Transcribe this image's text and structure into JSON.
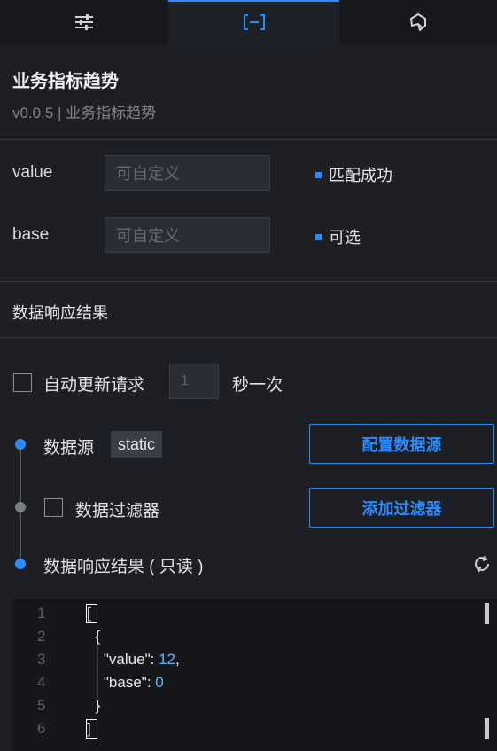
{
  "tabs": [
    {
      "name": "settings-sliders-icon"
    },
    {
      "name": "data-bracket-icon",
      "label": "[–]"
    },
    {
      "name": "interaction-icon"
    }
  ],
  "component": {
    "title": "业务指标趋势",
    "subtitle": "v0.0.5 | 业务指标趋势"
  },
  "fields": [
    {
      "label": "value",
      "placeholder": "可自定义",
      "status": "匹配成功"
    },
    {
      "label": "base",
      "placeholder": "可自定义",
      "status": "可选"
    }
  ],
  "section_title": "数据响应结果",
  "auto_update": {
    "label": "自动更新请求",
    "interval": "1",
    "suffix": "秒一次"
  },
  "datasource": {
    "label": "数据源",
    "type": "static",
    "button": "配置数据源"
  },
  "filter": {
    "label": "数据过滤器",
    "button": "添加过滤器"
  },
  "response": {
    "label": "数据响应结果 ( 只读 )"
  },
  "code": {
    "line_numbers": [
      "1",
      "2",
      "3",
      "4",
      "5",
      "6"
    ],
    "lines": [
      "[",
      "  {",
      "    \"value\": 12,",
      "    \"base\": 0",
      "  }",
      "]"
    ]
  },
  "colors": {
    "accent": "#2b8cff",
    "background": "#1d1f24",
    "code_number": "#5ab8ff"
  }
}
